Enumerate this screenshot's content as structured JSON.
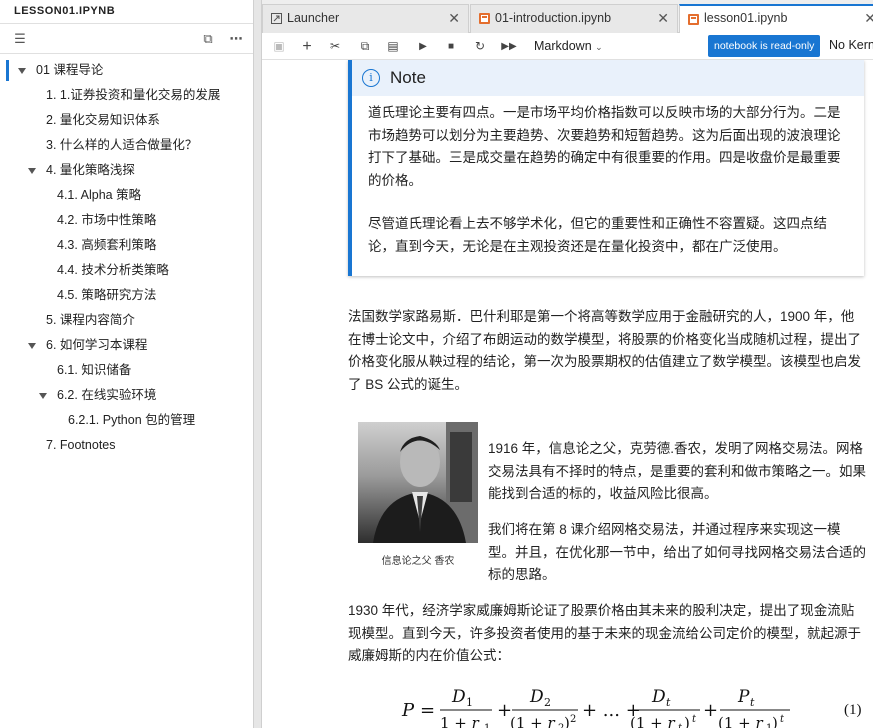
{
  "left_panel": {
    "title": "LESSON01.IPYNB",
    "toc": [
      {
        "label": "01 课程导论",
        "level": 0,
        "caret": true,
        "active": true
      },
      {
        "label": "1. 1.证券投资和量化交易的发展",
        "level": 1,
        "caret": false
      },
      {
        "label": "2. 量化交易知识体系",
        "level": 1,
        "caret": false
      },
      {
        "label": "3. 什么样的人适合做量化？",
        "level": 1,
        "caret": false
      },
      {
        "label": "4. 量化策略浅探",
        "level": 1,
        "caret": true
      },
      {
        "label": "4.1. Alpha 策略",
        "level": 2,
        "caret": false
      },
      {
        "label": "4.2. 市场中性策略",
        "level": 2,
        "caret": false
      },
      {
        "label": "4.3. 高频套利策略",
        "level": 2,
        "caret": false
      },
      {
        "label": "4.4. 技术分析类策略",
        "level": 2,
        "caret": false
      },
      {
        "label": "4.5. 策略研究方法",
        "level": 2,
        "caret": false
      },
      {
        "label": "5. 课程内容简介",
        "level": 1,
        "caret": false
      },
      {
        "label": "6. 如何学习本课程",
        "level": 1,
        "caret": true
      },
      {
        "label": "6.1. 知识储备",
        "level": 2,
        "caret": false
      },
      {
        "label": "6.2. 在线实验环境",
        "level": 2,
        "caret": true
      },
      {
        "label": "6.2.1. Python 包的管理",
        "level": 3,
        "caret": false
      },
      {
        "label": "7. Footnotes",
        "level": 1,
        "caret": false
      }
    ]
  },
  "tabs": [
    {
      "label": "Launcher",
      "icon": "launcher-icon",
      "active": false
    },
    {
      "label": "01-introduction.ipynb",
      "icon": "notebook-icon",
      "active": false
    },
    {
      "label": "lesson01.ipynb",
      "icon": "notebook-icon",
      "active": true
    }
  ],
  "toolbar": {
    "cell_type": "Markdown",
    "readonly_badge": "notebook is read-only",
    "kernel": "No Kern"
  },
  "note": {
    "icon_glyph": "i",
    "title": "Note",
    "p1": "道氏理论主要有四点。一是市场平均价格指数可以反映市场的大部分行为。二是市场趋势可以划分为主要趋势、次要趋势和短暂趋势。这为后面出现的波浪理论打下了基础。三是成交量在趋势的确定中有很重要的作用。四是收盘价是最重要的价格。",
    "p2": "尽管道氏理论看上去不够学术化，但它的重要性和正确性不容置疑。这四点结论，直到今天，无论是在主观投资还是在量化投资中，都在广泛使用。"
  },
  "body": {
    "p_bachelier": "法国数学家路易斯．巴什利耶是第一个将高等数学应用于金融研究的人，1900 年，他在博士论文中，介绍了布朗运动的数学模型，将股票的价格变化当成随机过程，提出了价格变化服从鞅过程的结论，第一次为股票期权的估值建立了数学模型。该模型也启发了 BS 公式的诞生。",
    "p_shannon_1": "1916 年，信息论之父，克劳德.香农，发明了网格交易法。网格交易法具有不择时的特点，是重要的套利和做市策略之一。如果能找到合适的标的，收益风险比很高。",
    "p_shannon_2": "我们将在第 8 课介绍网格交易法，并通过程序来实现这一模型。并且，在优化那一节中，给出了如何寻找网格交易法合适的标的思路。",
    "photo_caption": "信息论之父 香农",
    "p_williams": "1930 年代，经济学家威廉姆斯论证了股票价格由其未来的股利决定，提出了现金流贴现模型。直到今天，许多投资者使用的基于未来的现金流给公司定价的模型，就起源于威廉姆斯的内在价值公式：",
    "equation_number": "(1)"
  },
  "colors": {
    "accent": "#1976d2",
    "note_bg": "#e9f1fb",
    "notebook_icon": "#e46e2e"
  }
}
